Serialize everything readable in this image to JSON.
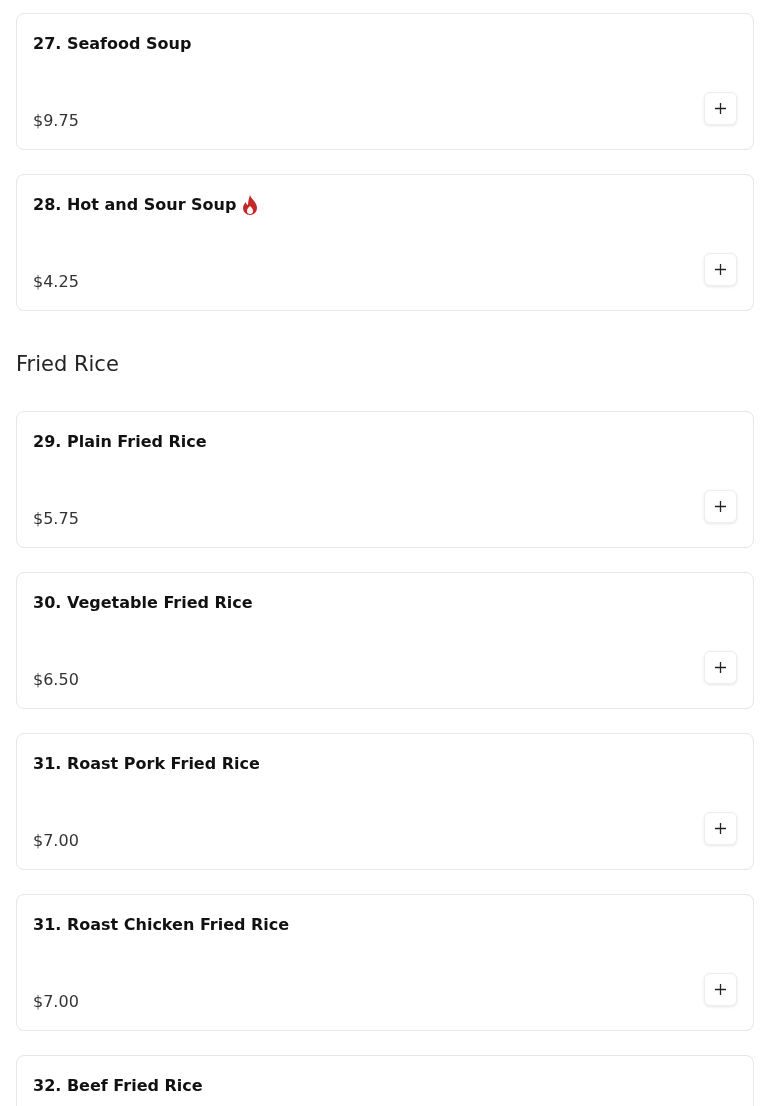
{
  "sections": [
    {
      "items": [
        {
          "name": "27. Seafood Soup",
          "spicy": false,
          "price": "$9.75"
        },
        {
          "name": "28. Hot and Sour Soup",
          "spicy": true,
          "price": "$4.25"
        }
      ]
    },
    {
      "title": "Fried Rice",
      "items": [
        {
          "name": "29. Plain Fried Rice",
          "spicy": false,
          "price": "$5.75"
        },
        {
          "name": "30. Vegetable Fried Rice",
          "spicy": false,
          "price": "$6.50"
        },
        {
          "name": "31. Roast Pork Fried Rice",
          "spicy": false,
          "price": "$7.00"
        },
        {
          "name": "31. Roast Chicken Fried Rice",
          "spicy": false,
          "price": "$7.00"
        },
        {
          "name": "32. Beef Fried Rice",
          "spicy": false
        }
      ]
    }
  ]
}
